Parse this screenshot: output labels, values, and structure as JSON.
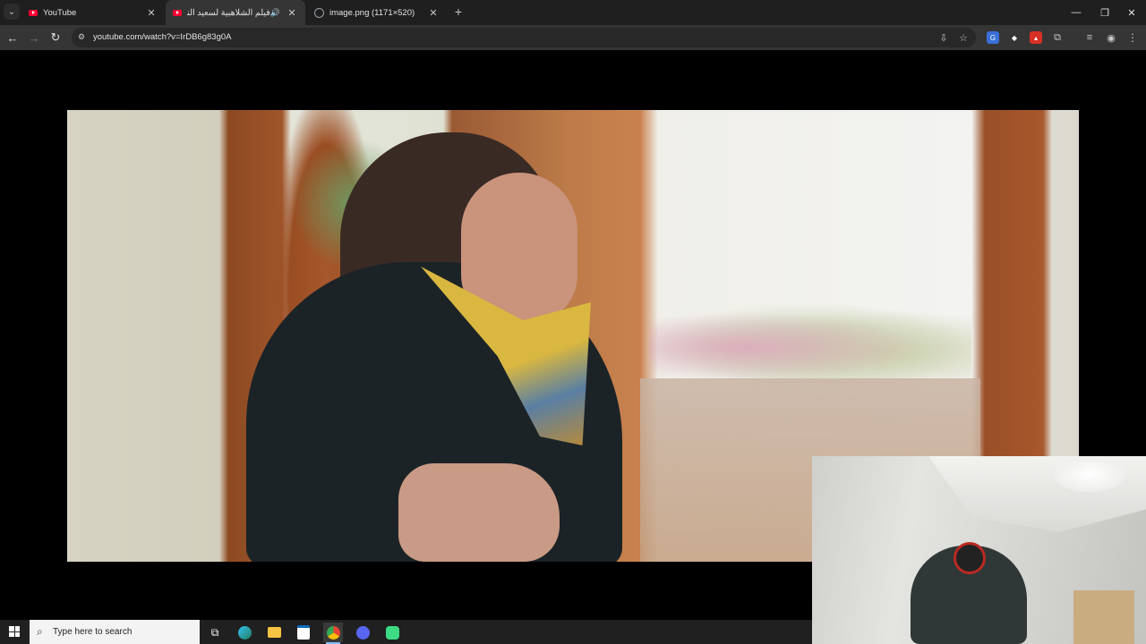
{
  "browser": {
    "tabs": [
      {
        "title": "YouTube",
        "active": false,
        "icon": "youtube-icon"
      },
      {
        "title": "فيلم الشلاهبية لسعيد الناصري",
        "active": true,
        "icon": "youtube-icon",
        "audio": true
      },
      {
        "title": "image.png (1171×520)",
        "active": false,
        "icon": "globe-icon"
      }
    ],
    "url": "youtube.com/watch?v=IrDB6g83g0A",
    "new_tab_symbol": "+",
    "close_symbol": "✕"
  },
  "taskbar": {
    "search_placeholder": "Type here to search",
    "apps": [
      "task-view-icon",
      "edge-icon",
      "file-explorer-icon",
      "store-icon",
      "chrome-icon",
      "discord-icon",
      "android-app-icon"
    ]
  },
  "colors": {
    "tabstrip": "#1f1f1f",
    "toolbar": "#353535",
    "omnibox": "#282828",
    "taskbar": "#202020"
  }
}
